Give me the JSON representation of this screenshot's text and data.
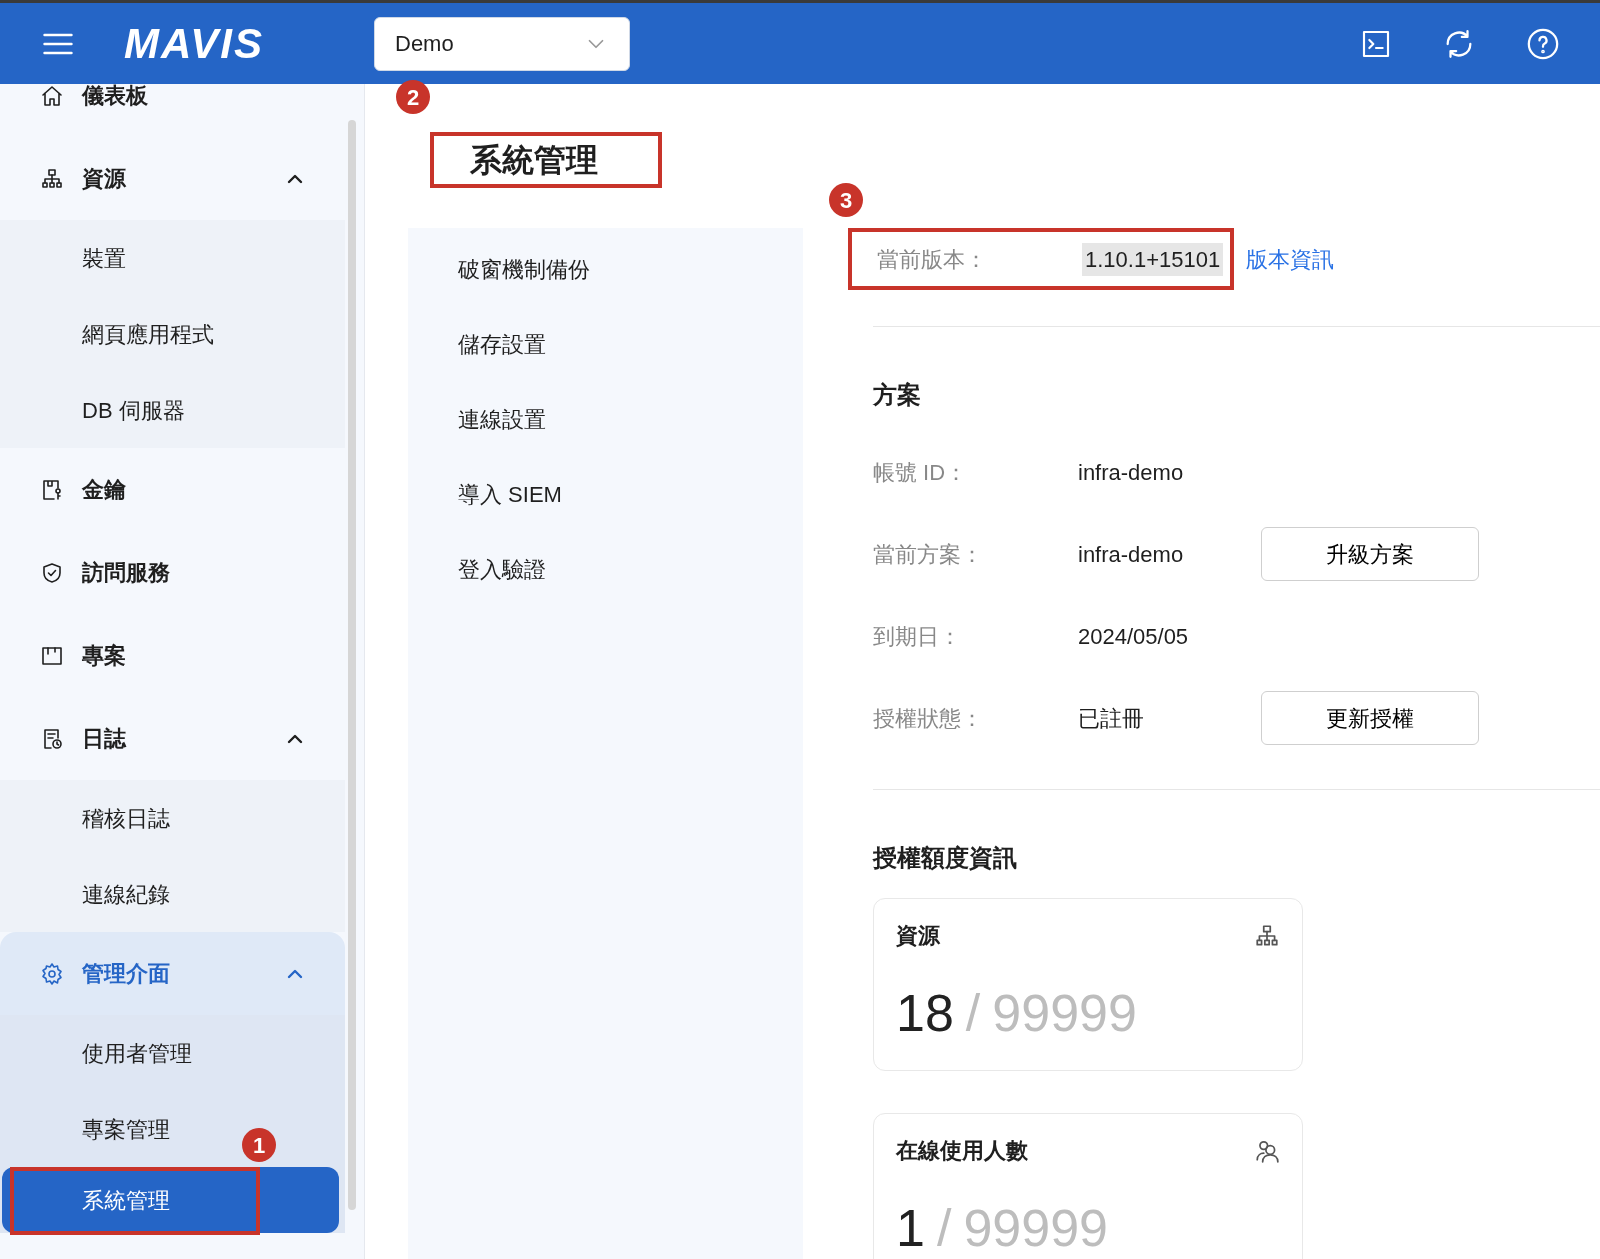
{
  "header": {
    "logo": "MAVIS",
    "workspace": {
      "value": "Demo"
    }
  },
  "sidebar": {
    "items": [
      {
        "label": "儀表板",
        "kind": "link",
        "selected": false
      },
      {
        "label": "資源",
        "kind": "group",
        "expanded": true,
        "selected": false,
        "children": [
          {
            "label": "裝置",
            "selected": false
          },
          {
            "label": "網頁應用程式",
            "selected": false
          },
          {
            "label": "DB 伺服器",
            "selected": false
          }
        ]
      },
      {
        "label": "金鑰",
        "kind": "link",
        "selected": false
      },
      {
        "label": "訪問服務",
        "kind": "link",
        "selected": false
      },
      {
        "label": "專案",
        "kind": "link",
        "selected": false
      },
      {
        "label": "日誌",
        "kind": "group",
        "expanded": true,
        "selected": false,
        "children": [
          {
            "label": "稽核日誌",
            "selected": false
          },
          {
            "label": "連線紀錄",
            "selected": false
          }
        ]
      },
      {
        "label": "管理介面",
        "kind": "group",
        "expanded": true,
        "selected": true,
        "children": [
          {
            "label": "使用者管理",
            "selected": false
          },
          {
            "label": "專案管理",
            "selected": false
          },
          {
            "label": "系統管理",
            "selected": true,
            "highlighted": true
          }
        ]
      }
    ]
  },
  "page_title": {
    "text": "系統管理",
    "highlighted": true
  },
  "submenu": [
    {
      "label": "破窗機制備份",
      "selected": false
    },
    {
      "label": "儲存設置",
      "selected": false
    },
    {
      "label": "連線設置",
      "selected": false
    },
    {
      "label": "導入 SIEM",
      "selected": false
    },
    {
      "label": "登入驗證",
      "selected": false
    }
  ],
  "version": {
    "label": "當前版本：",
    "value": "1.10.1+15101",
    "link": "版本資訊",
    "highlighted": true
  },
  "plan": {
    "heading": "方案",
    "rows": [
      {
        "label": "帳號 ID：",
        "value": "infra-demo"
      },
      {
        "label": "當前方案：",
        "value": "infra-demo",
        "button": "升級方案"
      },
      {
        "label": "到期日：",
        "value": "2024/05/05"
      },
      {
        "label": "授權狀態：",
        "value": "已註冊",
        "button": "更新授權"
      }
    ]
  },
  "quota": {
    "heading": "授權額度資訊",
    "cards": [
      {
        "title": "資源",
        "used": "18",
        "separator": "/",
        "total": "99999"
      },
      {
        "title": "在線使用人數",
        "used": "1",
        "separator": "/",
        "total": "99999"
      }
    ]
  },
  "annotations": [
    {
      "label": "1"
    },
    {
      "label": "2"
    },
    {
      "label": "3"
    }
  ]
}
